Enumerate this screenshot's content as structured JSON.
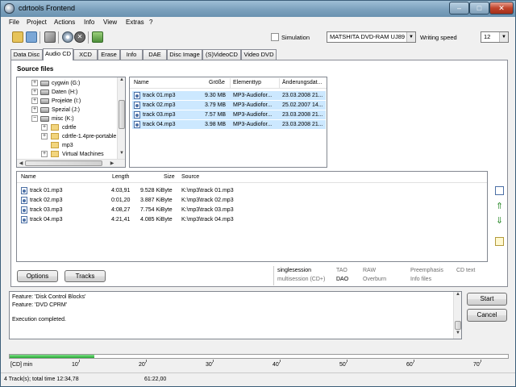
{
  "window": {
    "title": "cdrtools Frontend"
  },
  "menu": [
    "File",
    "Project",
    "Actions",
    "Info",
    "View",
    "Extras",
    "?"
  ],
  "toolbar": {
    "simulation_label": "Simulation",
    "drive_value": "MATSHITA DVD-RAM UJ89",
    "writing_speed_label": "Writing speed",
    "writing_speed_value": "12"
  },
  "tabs": [
    "Data Disc",
    "Audio CD",
    "XCD",
    "Erase",
    "Info",
    "DAE",
    "Disc Image",
    "(S)VideoCD",
    "Video DVD"
  ],
  "active_tab": "Audio CD",
  "source_files_label": "Source files",
  "tree": [
    {
      "label": "cygwin (G:)",
      "kind": "drive",
      "expander": "+"
    },
    {
      "label": "Daten (H:)",
      "kind": "drive",
      "expander": "+"
    },
    {
      "label": "Projekte (I:)",
      "kind": "drive",
      "expander": "+"
    },
    {
      "label": "Spezial (J:)",
      "kind": "drive",
      "expander": "+"
    },
    {
      "label": "misc (K:)",
      "kind": "drive",
      "expander": "−"
    },
    {
      "label": "cdrtfe",
      "kind": "folder",
      "expander": "+"
    },
    {
      "label": "cdrtfe-1.4pre-portable",
      "kind": "folder",
      "expander": "+"
    },
    {
      "label": "mp3",
      "kind": "folder",
      "expander": ""
    },
    {
      "label": "Virtual Machines",
      "kind": "folder",
      "expander": "+"
    }
  ],
  "source_list": {
    "columns": [
      "Name",
      "Größe",
      "Elementtyp",
      "Änderungsdat..."
    ],
    "rows": [
      {
        "name": "track 01.mp3",
        "size": "9.30 MB",
        "type": "MP3-Audiofor...",
        "date": "23.03.2008 21..."
      },
      {
        "name": "track 02.mp3",
        "size": "3.79 MB",
        "type": "MP3-Audiofor...",
        "date": "25.02.2007 14..."
      },
      {
        "name": "track 03.mp3",
        "size": "7.57 MB",
        "type": "MP3-Audiofor...",
        "date": "23.03.2008 21..."
      },
      {
        "name": "track 04.mp3",
        "size": "3.98 MB",
        "type": "MP3-Audiofor...",
        "date": "23.03.2008 21..."
      }
    ]
  },
  "track_list": {
    "columns": [
      "Name",
      "Length",
      "Size",
      "Source"
    ],
    "rows": [
      {
        "name": "track 01.mp3",
        "length": "4:03,91",
        "size": "9.528 KiByte",
        "source": "K:\\mp3\\track 01.mp3"
      },
      {
        "name": "track 02.mp3",
        "length": "0:01,20",
        "size": "3.887 KiByte",
        "source": "K:\\mp3\\track 02.mp3"
      },
      {
        "name": "track 03.mp3",
        "length": "4:08,27",
        "size": "7.754 KiByte",
        "source": "K:\\mp3\\track 03.mp3"
      },
      {
        "name": "track 04.mp3",
        "length": "4:21,41",
        "size": "4.085 KiByte",
        "source": "K:\\mp3\\track 04.mp3"
      }
    ]
  },
  "buttons": {
    "options": "Options",
    "tracks": "Tracks",
    "start": "Start",
    "cancel": "Cancel"
  },
  "options_grid": {
    "singlesession": "singlesession",
    "multisession": "multisession (CD+)",
    "tao": "TAO",
    "dao": "DAO",
    "raw": "RAW",
    "overburn": "Overburn",
    "preemphasis": "Preemphasis",
    "info_files": "Info files",
    "cd_text": "CD text"
  },
  "log": [
    "Feature: 'Disk Control Blocks'",
    "Feature: 'DVD CPRM'",
    "",
    "Execution completed."
  ],
  "progress": {
    "fill_fraction": 0.17
  },
  "ruler": {
    "unit": "[CD] min",
    "labels": [
      "10'",
      "20'",
      "30'",
      "40'",
      "50'",
      "60'",
      "70'"
    ]
  },
  "status": {
    "tracks": "4 Track(s); total time 12:34,78",
    "time": "61:22,00"
  },
  "colors": {
    "accent": "#25a832",
    "selection": "#cce8ff"
  }
}
